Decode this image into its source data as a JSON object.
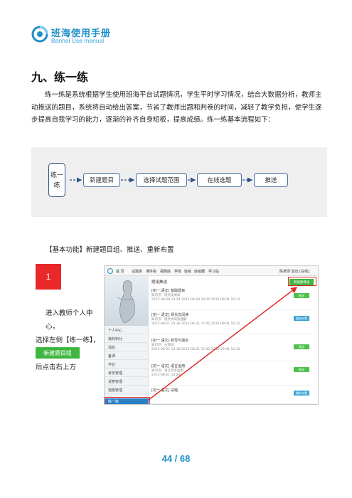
{
  "header": {
    "logo_title": "班海使用手册",
    "logo_subtitle": "Banhai Use manual"
  },
  "section": {
    "title": "九、练一练",
    "paragraph": "练一练是系统根据学生使用班海平台试题情况，学生平时学习情况，结合大数据分析，教师主动推送的题目，系统将自动给出答案，节省了教师出题和判卷的时间，减轻了教学负担，使学生逐步提高自我学习的能力，逐渐的补齐自身短板，提高成绩。练一练基本流程如下："
  },
  "flow": {
    "start": "练一练",
    "steps": [
      "新建题目",
      "选择试题范围",
      "在线选题",
      "推送"
    ]
  },
  "basic_functions": "【基本功能】新建题目组、推送、重新布置",
  "step1": {
    "number": "1",
    "text_line1": "进入教师个人中心，",
    "text_line2": "选择左侧【练一练】，然",
    "text_line3": "后点击右上方",
    "button_label": "新建题目组"
  },
  "screenshot": {
    "nav": [
      "首 页",
      "试题库",
      "课件库",
      "视频库",
      "学校",
      "班级",
      "班级圈",
      "学习站"
    ],
    "top_right": "陈老师  退出  [在线]",
    "menu": [
      "个人中心",
      "我的积分",
      "消息",
      "备课",
      "作业",
      "考务管理",
      "试卷管理",
      "错题管理",
      "练一练"
    ],
    "tab": "题组推送",
    "new_button": "新建题目组",
    "items": [
      {
        "title": "[初一 语文] 基础题目",
        "meta": "知识点：现代文阅读",
        "date": "2015-08-28 14:24   2015-08-28 14:35   2015-09-01 10:13",
        "badge": "推送"
      },
      {
        "title": "[初一 语文] 现代文阅读",
        "meta": "知识点：现代文阅读理解",
        "date": "2015-08-21 14:38   2015-08-21 17:42   2015-09-01 10:12",
        "badge": "重新布置"
      },
      {
        "title": "[初一 语文] 默写与填空",
        "meta": "知识点：古诗词",
        "date": "2015-08-21 14:38   2015-08-21 17:42   2015-09-01 10:12",
        "badge": "推送"
      },
      {
        "title": "[初一 语文] 语言运用",
        "meta": "知识点：语言文字运用",
        "date": "2015-08-21 14:29",
        "badge": "推送"
      },
      {
        "title": "[初一 语文] 试题",
        "meta": "",
        "date": "",
        "badge": "重新布置"
      }
    ]
  },
  "page_number": "44 / 68"
}
